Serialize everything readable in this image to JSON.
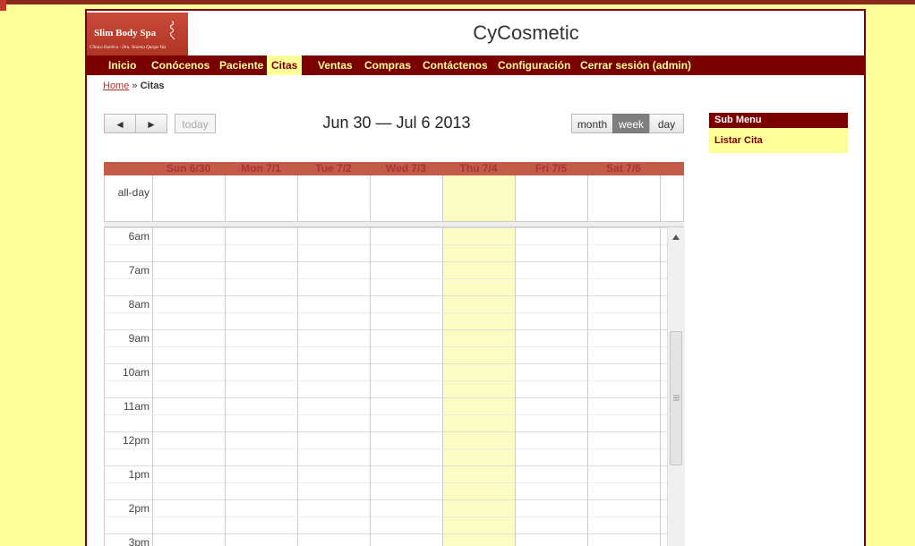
{
  "logo": {
    "name": "Slim Body Spa",
    "tagline": "Clínica Estética - Dra. Yesenia Quispe Vaz"
  },
  "site_title": "CyCosmetic",
  "nav": [
    "Inicio",
    "Conócenos",
    "Paciente",
    "Citas",
    "Ventas",
    "Compras",
    "Contáctenos",
    "Configuración",
    "Cerrar sesión (admin)"
  ],
  "nav_active": "Citas",
  "breadcrumb": {
    "home": "Home",
    "sep": "»",
    "current": "Citas"
  },
  "calendar": {
    "title": "Jun 30 — Jul 6 2013",
    "prev": "◄",
    "next": "►",
    "today": "today",
    "views": [
      "month",
      "week",
      "day"
    ],
    "active_view": "week",
    "days": [
      "Sun 6/30",
      "Mon 7/1",
      "Tue 7/2",
      "Wed 7/3",
      "Thu 7/4",
      "Fri 7/5",
      "Sat 7/6"
    ],
    "today_column": "Thu 7/4",
    "allday_label": "all-day",
    "times": [
      "6am",
      "7am",
      "8am",
      "9am",
      "10am",
      "11am",
      "12pm",
      "1pm",
      "2pm",
      "3pm"
    ]
  },
  "submenu": {
    "title": "Sub Menu",
    "items": [
      "Listar Cita"
    ]
  },
  "colors": {
    "accent": "#7a0000",
    "background": "#ffff99",
    "day_header": "#c45a48",
    "today_bg": "#fcfcc4"
  }
}
